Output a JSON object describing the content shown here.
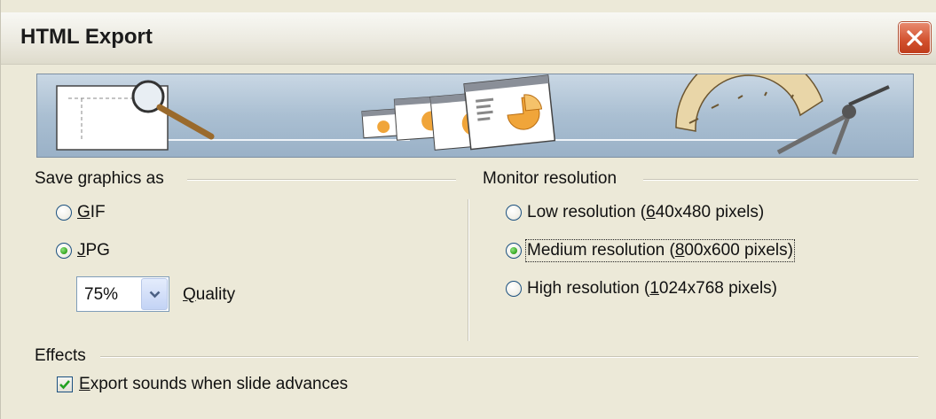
{
  "window": {
    "title": "HTML Export"
  },
  "banner": {
    "illustration": "banner-illustration"
  },
  "save_graphics": {
    "label": "Save graphics as",
    "gif": {
      "prefix": "",
      "mnemonic": "G",
      "rest": "IF",
      "selected": false
    },
    "jpg": {
      "prefix": "",
      "mnemonic": "J",
      "rest": "PG",
      "selected": true
    },
    "quality": {
      "value": "75%",
      "label_mnemonic": "Q",
      "label_rest": "uality"
    }
  },
  "monitor": {
    "label": "Monitor resolution",
    "low": {
      "prefix": "Low resolution (",
      "mnemonic": "6",
      "rest": "40x480 pixels)",
      "selected": false
    },
    "medium": {
      "prefix": "Medium resolution (",
      "mnemonic": "8",
      "rest": "00x600 pixels)",
      "selected": true
    },
    "high": {
      "prefix": "High resolution (",
      "mnemonic": "1",
      "rest": "024x768 pixels)",
      "selected": false
    }
  },
  "effects": {
    "label": "Effects",
    "export_sounds": {
      "mnemonic": "E",
      "rest": "xport sounds when slide advances",
      "checked": true
    }
  },
  "colors": {
    "titlebar_text": "#1b1b1b",
    "dialog_bg": "#ece9d8",
    "radio_dot": "#34a51f",
    "check_mark": "#21a121",
    "close_btn": "#d2502d"
  }
}
